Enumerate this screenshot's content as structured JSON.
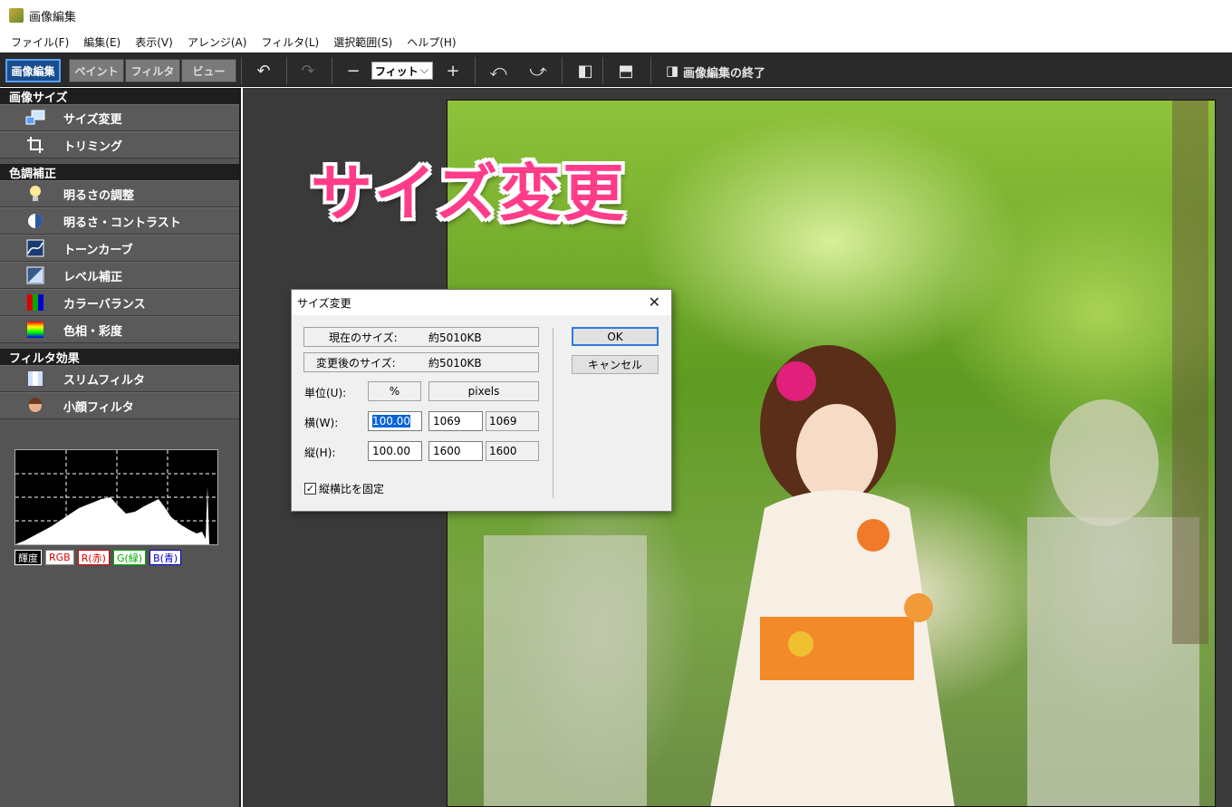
{
  "window": {
    "title": "画像編集"
  },
  "menu": [
    "ファイル(F)",
    "編集(E)",
    "表示(V)",
    "アレンジ(A)",
    "フィルタ(L)",
    "選択範囲(S)",
    "ヘルプ(H)"
  ],
  "toolbar": {
    "mode_tabs": [
      "画像編集",
      "ペイント",
      "フィルタ",
      "ビュー"
    ],
    "zoom_value": "フィット",
    "exit_label": "画像編集の終了"
  },
  "sidebar": {
    "sections": [
      {
        "title": "画像サイズ",
        "items": [
          "サイズ変更",
          "トリミング"
        ]
      },
      {
        "title": "色調補正",
        "items": [
          "明るさの調整",
          "明るさ・コントラスト",
          "トーンカーブ",
          "レベル補正",
          "カラーバランス",
          "色相・彩度"
        ]
      },
      {
        "title": "フィルタ効果",
        "items": [
          "スリムフィルタ",
          "小顔フィルタ"
        ]
      }
    ],
    "histogram_buttons": [
      "輝度",
      "RGB",
      "R(赤)",
      "G(緑)",
      "B(青)"
    ]
  },
  "overlay_title": "サイズ変更",
  "dialog": {
    "title": "サイズ変更",
    "current_size_label": "現在のサイズ:",
    "current_size_value": "約5010KB",
    "new_size_label": "変更後のサイズ:",
    "new_size_value": "約5010KB",
    "unit_label": "単位(U):",
    "unit_percent": "%",
    "unit_pixels": "pixels",
    "width_label": "横(W):",
    "width_percent": "100.00",
    "width_px": "1069",
    "width_px_ro": "1069",
    "height_label": "縦(H):",
    "height_percent": "100.00",
    "height_px": "1600",
    "height_px_ro": "1600",
    "keep_ratio_label": "縦横比を固定",
    "ok_label": "OK",
    "cancel_label": "キャンセル"
  }
}
